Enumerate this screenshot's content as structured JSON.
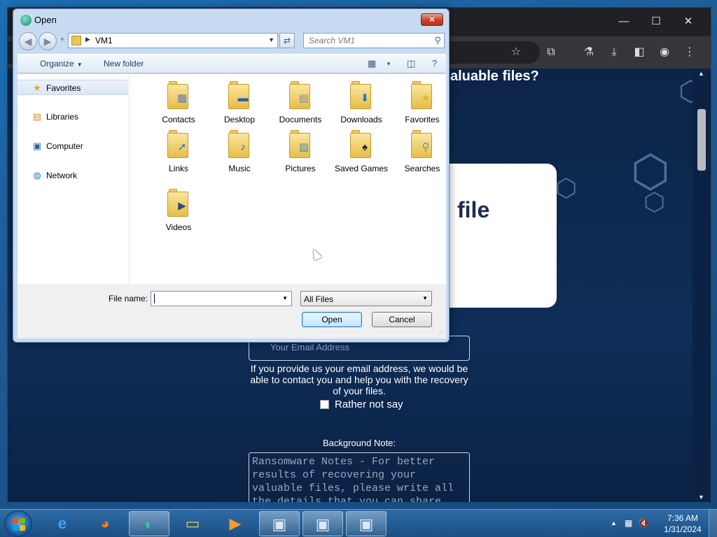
{
  "browser": {
    "page": {
      "heading_fragment": "aluable files?",
      "card_fragment": "file",
      "email_placeholder": "Your Email Address",
      "email_note": "If you provide us your email address, we would be able to contact you and help you with the recovery of your files.",
      "rather_label": "Rather not say",
      "background_note_label": "Background Note:",
      "notes_placeholder": "Ransomware Notes - For better results of recovering your valuable files, please write all the details that you can share"
    }
  },
  "dialog": {
    "title": "Open",
    "close_label": "✕",
    "address": {
      "location": "VM1"
    },
    "search_placeholder": "Search VM1",
    "toolbar": {
      "organize": "Organize",
      "new_folder": "New folder"
    },
    "nav_items": [
      {
        "label": "Favorites",
        "icon": "star-icon"
      },
      {
        "label": "Libraries",
        "icon": "libraries-icon"
      },
      {
        "label": "Computer",
        "icon": "computer-icon"
      },
      {
        "label": "Network",
        "icon": "network-icon"
      }
    ],
    "folders": [
      {
        "label": "Contacts"
      },
      {
        "label": "Desktop"
      },
      {
        "label": "Documents"
      },
      {
        "label": "Downloads"
      },
      {
        "label": "Favorites"
      },
      {
        "label": "Links"
      },
      {
        "label": "Music"
      },
      {
        "label": "Pictures"
      },
      {
        "label": "Saved Games"
      },
      {
        "label": "Searches"
      },
      {
        "label": "Videos"
      }
    ],
    "file_name_label": "File name:",
    "file_name_value": "",
    "filter_value": "All Files",
    "open_button": "Open",
    "cancel_button": "Cancel"
  },
  "taskbar": {
    "clock_time": "7:36 AM",
    "clock_date": "1/31/2024"
  },
  "colors": {
    "page_background": "#0c2447",
    "card_text": "#1e2b4f",
    "close_button": "#c7432c"
  }
}
